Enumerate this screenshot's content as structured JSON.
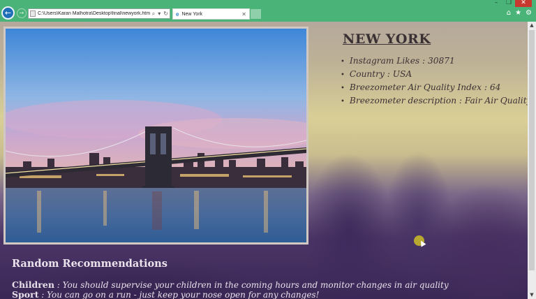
{
  "browser": {
    "url": "C:\\Users\\Karan Malhotra\\Desktop\\final\\newyork.htm",
    "search_glyph": "⌕",
    "dropdown_glyph": "▾",
    "refresh_glyph": "↻",
    "tab_title": "New York",
    "tab_close": "✕",
    "win_minimize": "–",
    "win_restore": "❐",
    "win_close": "✕",
    "back_glyph": "←",
    "forward_glyph": "→",
    "home_glyph": "⌂",
    "favorites_glyph": "★",
    "tools_glyph": "⚙",
    "icons": [
      "back-icon",
      "forward-icon",
      "search-icon",
      "dropdown-icon",
      "refresh-icon",
      "ie-icon",
      "close-icon",
      "home-icon",
      "favorites-icon",
      "gear-icon"
    ]
  },
  "page": {
    "city_title": "NEW YORK",
    "facts": [
      "Instagram Likes : 30871",
      "Country : USA",
      "Breezometer Air Quality Index : 64",
      "Breezometer description : Fair Air Quality"
    ],
    "recommendations_title": "Random Recommendations",
    "recommendations": [
      {
        "label": "Children",
        "text": " : You should supervise your children in the coming hours and monitor changes in air quality"
      },
      {
        "label": "Sport",
        "text": " : You can go on a run - just keep your nose open for any changes!"
      }
    ]
  },
  "scrollbar": {
    "up": "▲",
    "down": "▼"
  },
  "colors": {
    "chrome": "#4ab378",
    "back_button": "#1f6fb8",
    "title_text": "#3b3033",
    "close_button": "#c8382f"
  }
}
